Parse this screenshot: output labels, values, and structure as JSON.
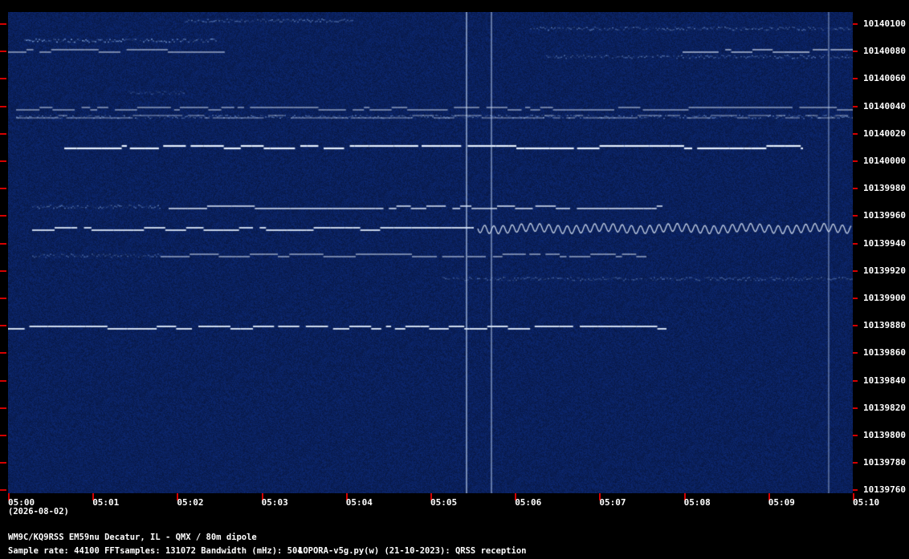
{
  "window": {
    "station": "WM9C/KQ9RSS EM59nu Decatur, IL - QMX / 80m dipole",
    "date": "(2026-08-02)",
    "params": "Sample rate: 44100    FFTsamples: 131072    Bandwidth (mHz): 504",
    "software": "LOPORA-v5g.py(w) (21-10-2023): QRSS reception"
  },
  "frequency_axis": {
    "labels": [
      "10140100",
      "10140080",
      "10140060",
      "10140040",
      "10140020",
      "10140000",
      "10139980",
      "10139960",
      "10139940",
      "10139920",
      "10139900",
      "10139880",
      "10139860",
      "10139840",
      "10139820",
      "10139800",
      "10139780",
      "10139760"
    ]
  },
  "time_axis": {
    "labels": [
      "05:00",
      "05:01",
      "05:02",
      "05:03",
      "05:04",
      "05:05",
      "05:06",
      "05:07",
      "05:08",
      "05:09",
      "05:10"
    ]
  },
  "colors": {
    "background": "#000000",
    "waterfall_base": "#0a1f55",
    "signal": "#e8f2ff",
    "tick": "#d40000",
    "text": "#ffffff"
  }
}
